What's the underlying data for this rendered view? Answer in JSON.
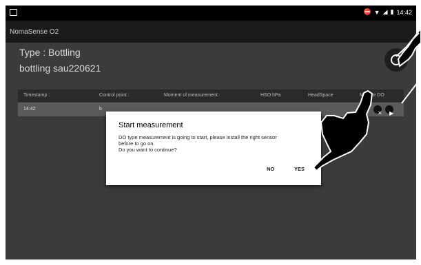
{
  "status_bar": {
    "time": "14:42"
  },
  "app": {
    "title": "NomaSense O2"
  },
  "header": {
    "type_label": "Type : Bottling",
    "name": "bottling sau220621"
  },
  "table": {
    "columns": [
      "Timestamp :",
      "Control point :",
      "Moment of measurement:",
      "HSO hPa",
      "HeadSpace",
      "Mesure DO"
    ],
    "rows": [
      {
        "timestamp": "14:42",
        "control_point_partial": "b"
      }
    ]
  },
  "dialog": {
    "title": "Start measurement",
    "message": "DO type measurement is going to start, please install the right sensor\nbefore to go on.\n Do you want to continue?",
    "no_label": "NO",
    "yes_label": "YES"
  },
  "colors": {
    "app_background": "#3b3b3b",
    "dialog_background": "#ffffff",
    "status_bar": "#000000"
  }
}
